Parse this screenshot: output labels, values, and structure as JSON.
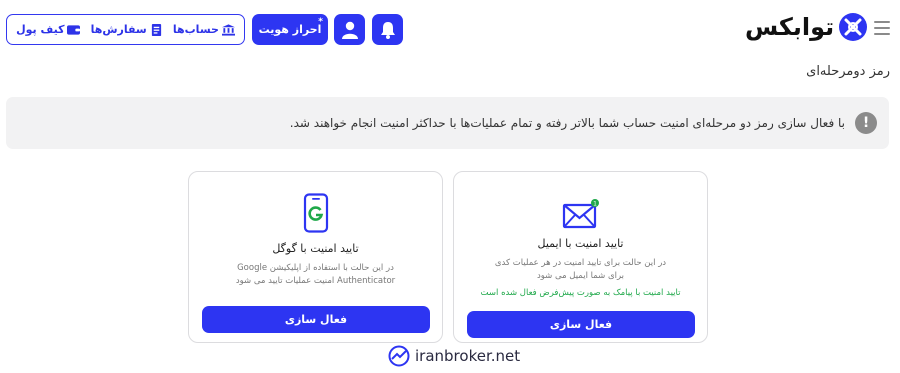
{
  "nav": {
    "accounts_label": "حساب‌ها",
    "orders_label": "سفارش‌ها",
    "wallet_label": "کیف پول",
    "kyc_label": "احراز هویت",
    "kyc_badge": "*"
  },
  "brand": {
    "logo_text": "توابکس"
  },
  "page": {
    "title": "رمز دومرحله‌ای"
  },
  "alert": {
    "icon": "!",
    "text": "با فعال سازی رمز دو مرحله‌ای امنیت حساب شما بالاتر رفته و تمام عملیات‌ها با حداکثر امنیت انجام خواهند شد."
  },
  "cards": {
    "email": {
      "title": "تایید امنیت با ایمیل",
      "desc": "در این حالت برای تایید امنیت در هر عملیات کدی برای شما ایمیل می شود",
      "note": "تایید امنیت با پیامک به صورت پیش‌فرض فعال شده است",
      "badge": "1",
      "button": "فعال سازی"
    },
    "google": {
      "title": "تایید امنیت با گوگل",
      "desc": "در این حالت با استفاده از اپلیکیشن Google Authenticator امنیت عملیات تایید می شود",
      "button": "فعال سازی"
    }
  },
  "watermark": {
    "text": "iranbroker.net"
  },
  "colors": {
    "primary": "#2d35f2",
    "success": "#1fa84a",
    "alert_bg": "#f2f2f3"
  }
}
